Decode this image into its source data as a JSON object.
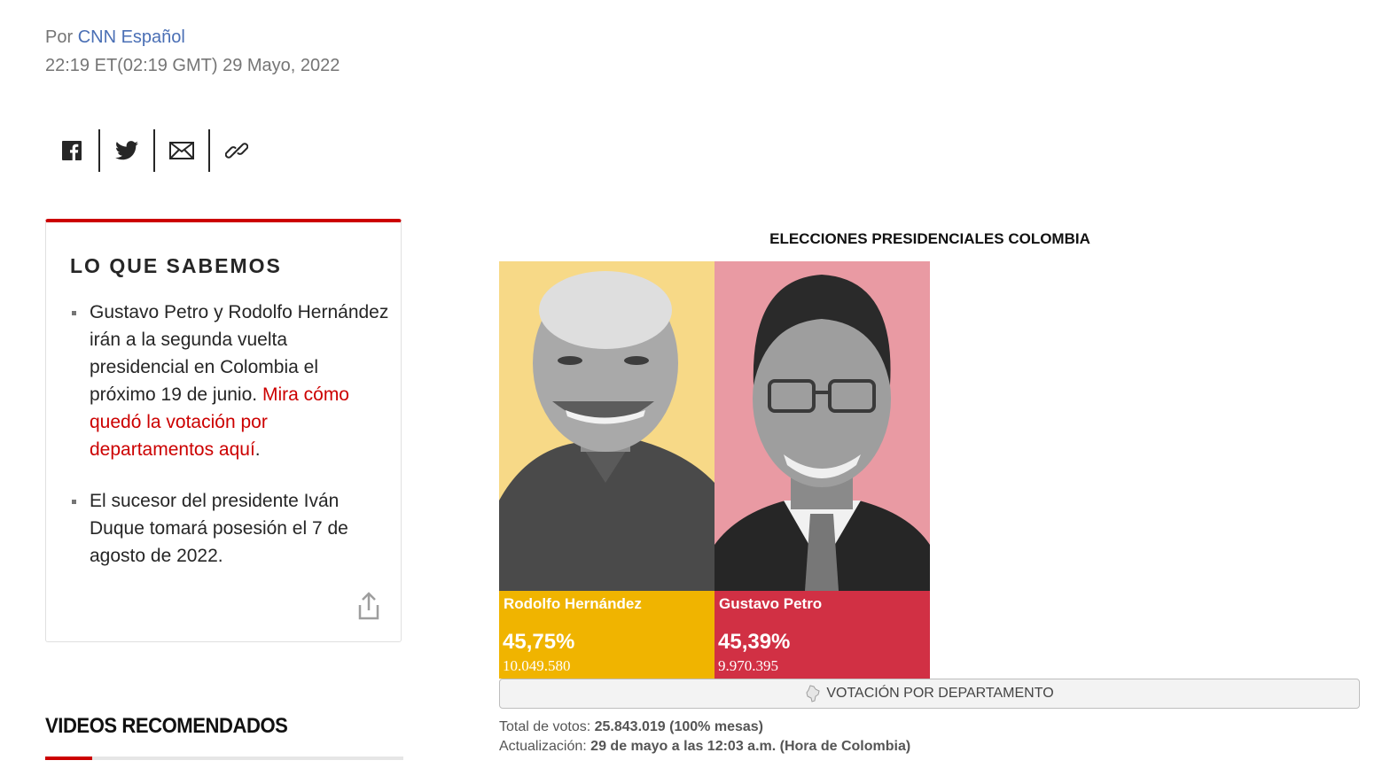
{
  "byline": {
    "prefix": "Por",
    "author": "CNN Español",
    "timestamp": "22:19 ET(02:19 GMT) 29 Mayo, 2022"
  },
  "share": {
    "items": [
      "facebook-icon",
      "twitter-icon",
      "mail-icon",
      "link-icon"
    ]
  },
  "sabemos": {
    "title": "LO QUE SABEMOS",
    "bullet1_text": "Gustavo Petro y Rodolfo Hernández irán a la segunda vuelta presidencial en Colombia el próximo 19 de junio.",
    "bullet1_link": "Mira cómo quedó la votación por departamentos aquí",
    "bullet1_end": ".",
    "bullet2_text": "El sucesor del presidente Iván Duque tomará posesión el 7 de agosto de 2022."
  },
  "videos": {
    "title": "VIDEOS RECOMENDADOS"
  },
  "election": {
    "title": "ELECCIONES PRESIDENCIALES COLOMBIA",
    "candidates": [
      {
        "name": "Rodolfo Hernández",
        "percent": "45,75%",
        "votes": "10.049.580",
        "color": "#f0b400",
        "bg": "#f7d987"
      },
      {
        "name": "Gustavo Petro",
        "percent": "45,39%",
        "votes": "9.970.395",
        "color": "#d13044",
        "bg": "#e99aa3"
      }
    ],
    "button_label": "VOTACIÓN POR DEPARTAMENTO",
    "total_label": "Total de votos:",
    "total_value": "25.843.019 (100% mesas)",
    "update_label": "Actualización:",
    "update_value": "29 de mayo a las 12:03 a.m. (Hora de Colombia)"
  }
}
